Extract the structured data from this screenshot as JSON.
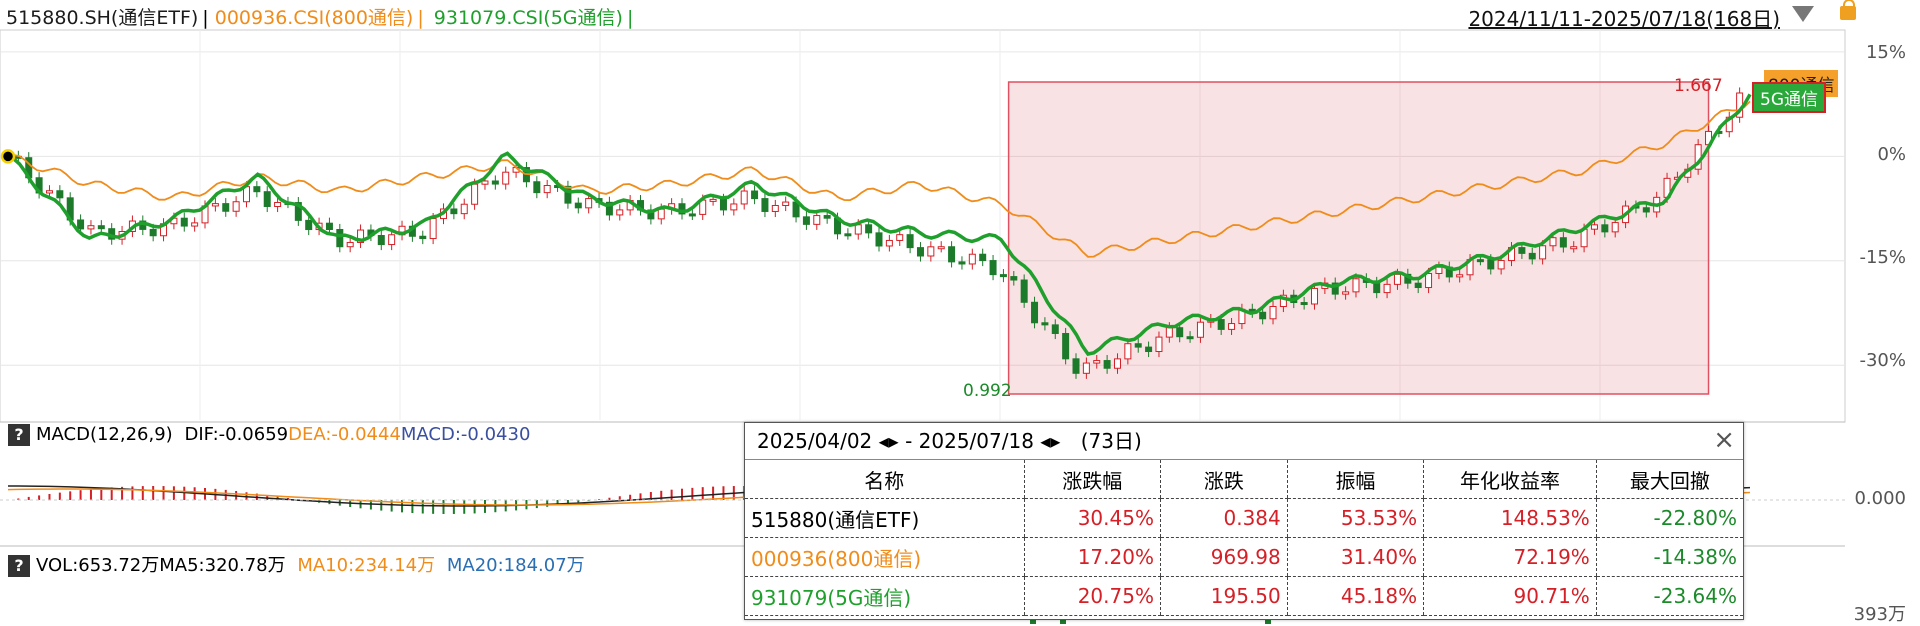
{
  "header": {
    "series1": "515880.SH(通信ETF)",
    "series2": "000936.CSI(800通信)",
    "series3": "931079.CSI(5G通信)",
    "range": "2024/11/11-2025/07/18(168日)"
  },
  "colors": {
    "s1": "#1b1b1b",
    "s2": "#f08c1a",
    "s3": "#1fa02c",
    "up": "#d42026",
    "down": "#1c7a2b"
  },
  "icons": [
    "dropdown-triangle-icon",
    "lock-icon",
    "help-icon",
    "close-icon"
  ],
  "main_axis": [
    "15%",
    "0%",
    "-15%",
    "-30%"
  ],
  "macd": {
    "label": "MACD(12,26,9)",
    "dif": "DIF:-0.0659",
    "dea": "DEA:-0.0444",
    "macd": "MACD:-0.0430",
    "axis": "0.000"
  },
  "vol": {
    "label": "VOL:653.72万",
    "ma5": "MA5:320.78万",
    "ma10": "MA10:234.14万",
    "ma20": "MA20:184.07万",
    "axis": "393万"
  },
  "annotations": {
    "low": "0.992",
    "high": "1.667",
    "tag_800": "800通信",
    "tag_5g": "5G通信"
  },
  "popup": {
    "title_start": "2025/04/02",
    "title_end": "2025/07/18",
    "days": "(73日)",
    "headers": [
      "名称",
      "涨跌幅",
      "涨跌",
      "振幅",
      "年化收益率",
      "最大回撤"
    ],
    "rows": [
      [
        "515880(通信ETF)",
        "30.45%",
        "0.384",
        "53.53%",
        "148.53%",
        "-22.80%"
      ],
      [
        "000936(800通信)",
        "17.20%",
        "969.98",
        "31.40%",
        "72.19%",
        "-14.38%"
      ],
      [
        "931079(5G通信)",
        "20.75%",
        "195.50",
        "45.18%",
        "90.71%",
        "-23.64%"
      ]
    ]
  },
  "chart_data": {
    "type": "line",
    "title": "",
    "xlabel": "",
    "ylabel": "",
    "ylim": [
      -35,
      17
    ],
    "x": [
      0,
      8,
      16,
      24,
      32,
      40,
      48,
      56,
      64,
      72,
      80,
      88,
      96,
      104,
      112,
      120,
      128,
      136,
      144,
      152,
      160,
      168
    ],
    "series": [
      {
        "name": "000936.CSI(800通信)",
        "values": [
          0,
          -4,
          -6,
          -3,
          -5,
          -3,
          -1,
          -5,
          -4,
          -2,
          -6,
          -4,
          -7,
          -14,
          -12,
          -10,
          -8,
          -6,
          -4,
          -2,
          2,
          8
        ]
      },
      {
        "name": "931079.CSI(5G通信)",
        "values": [
          0,
          -12,
          -9,
          -3,
          -12,
          -10,
          0,
          -6,
          -8,
          -4,
          -9,
          -11,
          -12,
          -28,
          -24,
          -22,
          -18,
          -17,
          -14,
          -10,
          -6,
          9
        ]
      },
      {
        "name": "515880.SH(通信ETF)",
        "values": [
          0,
          -11,
          -10,
          -5,
          -12,
          -11,
          -2,
          -7,
          -8,
          -6,
          -10,
          -13,
          -16,
          -31,
          -26,
          -23,
          -19,
          -18,
          -15,
          -12,
          -6,
          8
        ]
      }
    ]
  }
}
